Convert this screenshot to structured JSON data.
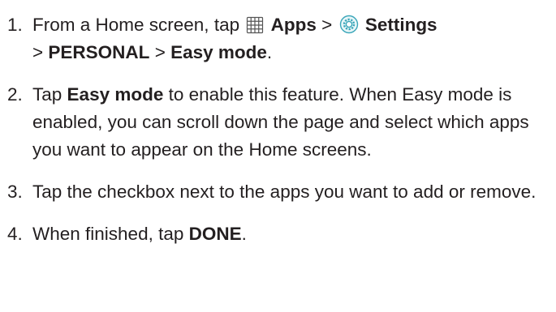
{
  "steps": [
    {
      "number": "1.",
      "text_1": "From a Home screen, tap",
      "apps_icon": "apps-grid-icon",
      "apps_label": "Apps",
      "sep_1": ">",
      "settings_icon": "settings-gear-icon",
      "settings_label": "Settings",
      "sep_2": ">",
      "personal_label": "PERSONAL",
      "sep_3": ">",
      "easy_mode_label": "Easy mode",
      "end": "."
    },
    {
      "number": "2.",
      "text_1": "Tap",
      "easy_mode_label": "Easy mode",
      "text_2": "to enable this feature. When Easy mode is enabled, you can scroll down the page and select which apps you want to appear on the Home screens."
    },
    {
      "number": "3.",
      "text_1": "Tap the checkbox next to the apps you want to add or remove."
    },
    {
      "number": "4.",
      "text_1": "When finished, tap",
      "done_label": "DONE",
      "end": "."
    }
  ],
  "colors": {
    "text": "#231f20",
    "icon_stroke": "#555555",
    "settings_teal": "#3aa6b9"
  }
}
